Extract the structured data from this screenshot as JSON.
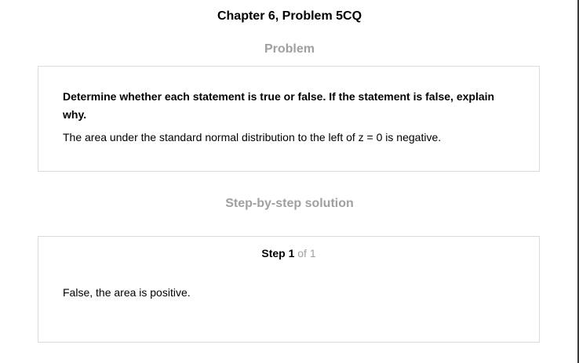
{
  "page": {
    "title": "Chapter 6, Problem 5CQ"
  },
  "problem": {
    "heading": "Problem",
    "question": "Determine whether each statement is true or false. If the statement is false, explain why.",
    "statement": "The area under the standard normal distribution to the left of z = 0 is negative."
  },
  "solution": {
    "heading": "Step-by-step solution",
    "step_label": "Step 1",
    "step_of": "of 1",
    "answer": "False, the area is positive."
  }
}
